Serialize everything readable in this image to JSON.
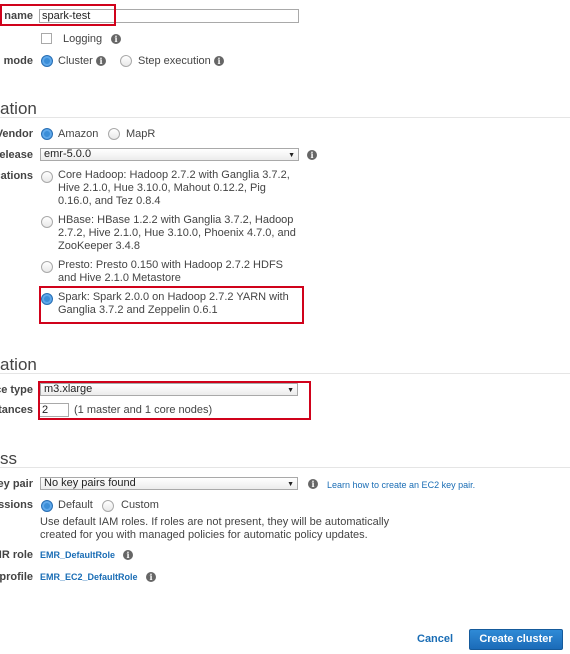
{
  "general": {
    "name_label": "name",
    "name_value": "spark-test",
    "logging_label": "Logging",
    "launch_mode_label": "n mode",
    "launch_modes": [
      "Cluster",
      "Step execution"
    ]
  },
  "software": {
    "title": "ation",
    "vendor_label": "Vendor",
    "vendors": [
      "Amazon",
      "MapR"
    ],
    "release_label": "elease",
    "release_value": "emr-5.0.0",
    "applications_label": "cations",
    "applications": [
      "Core Hadoop: Hadoop 2.7.2 with Ganglia 3.7.2, Hive 2.1.0, Hue 3.10.0, Mahout 0.12.2, Pig 0.16.0, and Tez 0.8.4",
      "HBase: HBase 1.2.2 with Ganglia 3.7.2, Hadoop 2.7.2, Hive 2.1.0, Hue 3.10.0, Phoenix 4.7.0, and ZooKeeper 3.4.8",
      "Presto: Presto 0.150 with Hadoop 2.7.2 HDFS and Hive 2.1.0 Metastore",
      "Spark: Spark 2.0.0 on Hadoop 2.7.2 YARN with Ganglia 3.7.2 and Zeppelin 0.6.1"
    ]
  },
  "hardware": {
    "title": "ation",
    "instance_type_label": "ce type",
    "instance_type_value": "m3.xlarge",
    "instances_label": "tances",
    "instances_value": "2",
    "instances_note": "(1 master and 1 core nodes)"
  },
  "security": {
    "title": "ss",
    "key_pair_label": "ey pair",
    "key_pair_value": "No key pairs found",
    "key_pair_link": "Learn how to create an EC2 key pair.",
    "permissions_label": "ssions",
    "permissions": [
      "Default",
      "Custom"
    ],
    "permissions_note": "Use default IAM roles. If roles are not present, they will be automatically created for you with managed policies for automatic policy updates.",
    "emr_role_label": "MR role",
    "emr_role_value": "EMR_DefaultRole",
    "profile_label": "profile",
    "profile_value": "EMR_EC2_DefaultRole"
  },
  "footer": {
    "cancel_label": "Cancel",
    "create_label": "Create cluster"
  },
  "colors": {
    "accent": "#1a6db5",
    "highlight": "#d0021b"
  },
  "icons": {
    "info": "info-icon",
    "dropdown": "chevron-down-icon"
  }
}
